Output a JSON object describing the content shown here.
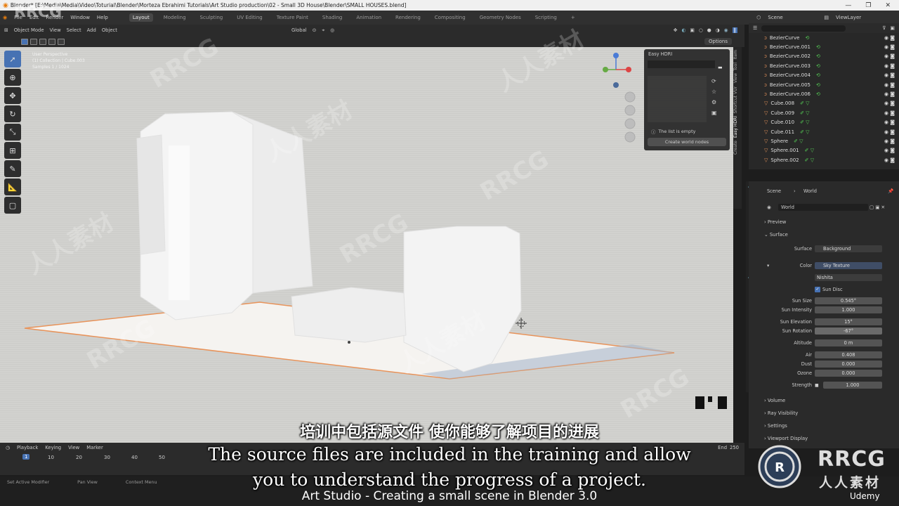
{
  "window": {
    "title": "Blender* [E:\\Media\\Media\\Video\\Toturial\\Blender\\Morteza Ebrahimi Tutorials\\Art Studio production\\02 - Small 3D House\\Blender\\SMALL HOUSES.blend]"
  },
  "menu": {
    "items": [
      "File",
      "Edit",
      "Render",
      "Window",
      "Help"
    ]
  },
  "workspaces": {
    "tabs": [
      "Layout",
      "Modeling",
      "Sculpting",
      "UV Editing",
      "Texture Paint",
      "Shading",
      "Animation",
      "Rendering",
      "Compositing",
      "Geometry Nodes",
      "Scripting"
    ],
    "active": "Layout"
  },
  "scene_selector": {
    "label": "Scene"
  },
  "viewlayer_selector": {
    "label": "ViewLayer"
  },
  "viewport_header": {
    "mode": "Object Mode",
    "menus": [
      "View",
      "Select",
      "Add",
      "Object"
    ],
    "orientation": "Global",
    "options": "Options"
  },
  "viewport_info": {
    "line1": "User Perspective",
    "line2": "(1) Collection | Cube.003",
    "line3": "Samples 1 / 1024"
  },
  "easy_hdri": {
    "title": "Easy HDRI",
    "empty_text": "The list is empty",
    "create_button": "Create world nodes"
  },
  "n_tabs": [
    "Item",
    "Tool",
    "View",
    "Shortcut VUr",
    "Easy HDRI",
    "Create"
  ],
  "outliner": {
    "items": [
      "BezierCurve",
      "BezierCurve.001",
      "BezierCurve.002",
      "BezierCurve.003",
      "BezierCurve.004",
      "BezierCurve.005",
      "BezierCurve.006",
      "Cube.008",
      "Cube.009",
      "Cube.010",
      "Cube.011",
      "Sphere",
      "Sphere.001",
      "Sphere.002"
    ]
  },
  "properties": {
    "breadcrumb": {
      "scene": "Scene",
      "world": "World"
    },
    "world_name": "World",
    "sections": {
      "preview": "Preview",
      "surface": "Surface",
      "volume": "Volume",
      "ray_visibility": "Ray Visibility",
      "settings": "Settings",
      "viewport_display": "Viewport Display"
    },
    "surface_label": "Surface",
    "surface_value": "Background",
    "color_label": "Color",
    "color_value": "Sky Texture",
    "sky_type": "Nishita",
    "sun_disc": "Sun Disc",
    "sun_size_label": "Sun Size",
    "sun_size": "0.545°",
    "sun_intensity_label": "Sun Intensity",
    "sun_intensity": "1.000",
    "sun_elevation_label": "Sun Elevation",
    "sun_elevation": "15°",
    "sun_rotation_label": "Sun Rotation",
    "sun_rotation": "-67°",
    "altitude_label": "Altitude",
    "altitude": "0 m",
    "air_label": "Air",
    "air": "0.408",
    "dust_label": "Dust",
    "dust": "0.000",
    "ozone_label": "Ozone",
    "ozone": "0.000",
    "strength_label": "Strength",
    "strength": "1.000"
  },
  "timeline": {
    "menus": [
      "Playback",
      "Keying",
      "View",
      "Marker"
    ],
    "ticks": [
      "10",
      "20",
      "30",
      "40",
      "50"
    ],
    "current_frame": "1",
    "end_label": "End",
    "end_value": "250"
  },
  "statusbar": {
    "left": "Set Active Modifier",
    "pan": "Pan View",
    "context": "Context Menu"
  },
  "subtitles": {
    "chinese": "培训中包括源文件 使你能够了解项目的进展",
    "english_line1": "The source files are included in the training and allow",
    "english_line2": "you to understand the progress of a project.",
    "course": "Art Studio - Creating a small scene in Blender 3.0"
  },
  "branding": {
    "udemy": "Udemy",
    "rrcg": "RRCG",
    "rrcg_cn": "人人素材",
    "watermark": "RRCG",
    "watermark_cn": "人人素材"
  },
  "colors": {
    "accent": "#4772b3",
    "selection_outline": "#e8935a",
    "viewport_bg": "#d4d4d1"
  }
}
